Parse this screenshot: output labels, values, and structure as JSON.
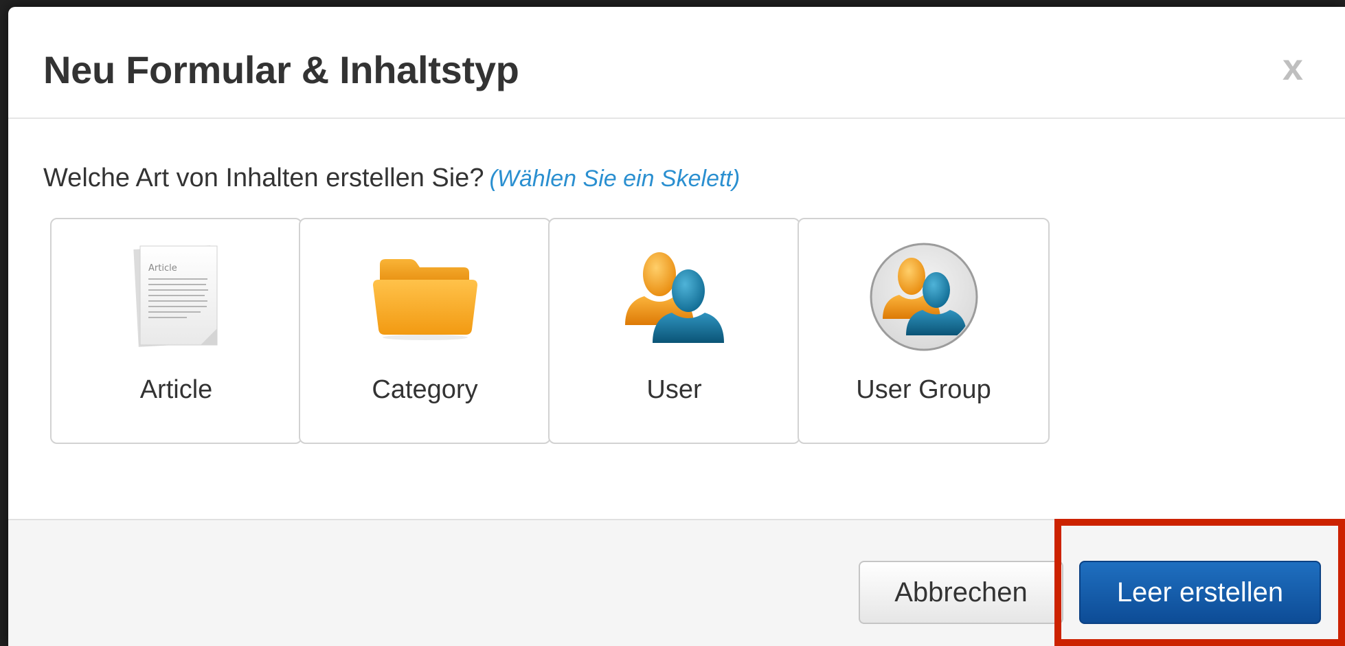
{
  "dialog": {
    "title": "Neu Formular & Inhaltstyp",
    "close_label": "x",
    "prompt": "Welche Art von Inhalten erstellen Sie?",
    "prompt_hint": "(Wählen Sie ein Skelett)"
  },
  "tiles": [
    {
      "label": "Article",
      "icon": "article-document-icon"
    },
    {
      "label": "Category",
      "icon": "folder-icon"
    },
    {
      "label": "User",
      "icon": "user-icon"
    },
    {
      "label": "User Group",
      "icon": "user-group-icon"
    }
  ],
  "footer": {
    "cancel_label": "Abbrechen",
    "create_label": "Leer erstellen"
  },
  "colors": {
    "accent": "#2a8fd0",
    "primary_button": "#0d4c96",
    "highlight": "#cc2200"
  }
}
